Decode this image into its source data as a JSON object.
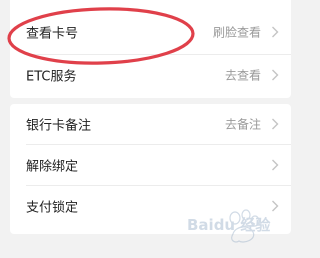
{
  "colors": {
    "page_background": "#f2f2f2",
    "card_background": "#ffffff",
    "label_text": "#222222",
    "value_text": "#9a9a9a",
    "annotation_circle": "#e0404a"
  },
  "settings": {
    "rows": [
      {
        "label": "查看卡号",
        "value": "刷脸查看",
        "icon": "chevron-right-icon"
      },
      {
        "label": "ETC服务",
        "value": "去查看",
        "icon": "chevron-right-icon"
      },
      {
        "label": "银行卡备注",
        "value": "去备注",
        "icon": "chevron-right-icon"
      },
      {
        "label": "解除绑定",
        "value": "",
        "icon": "chevron-right-icon"
      },
      {
        "label": "支付锁定",
        "value": "",
        "icon": "chevron-right-icon"
      }
    ]
  },
  "watermark": {
    "text": "Baidu 经验",
    "logo": "paw-logo"
  }
}
